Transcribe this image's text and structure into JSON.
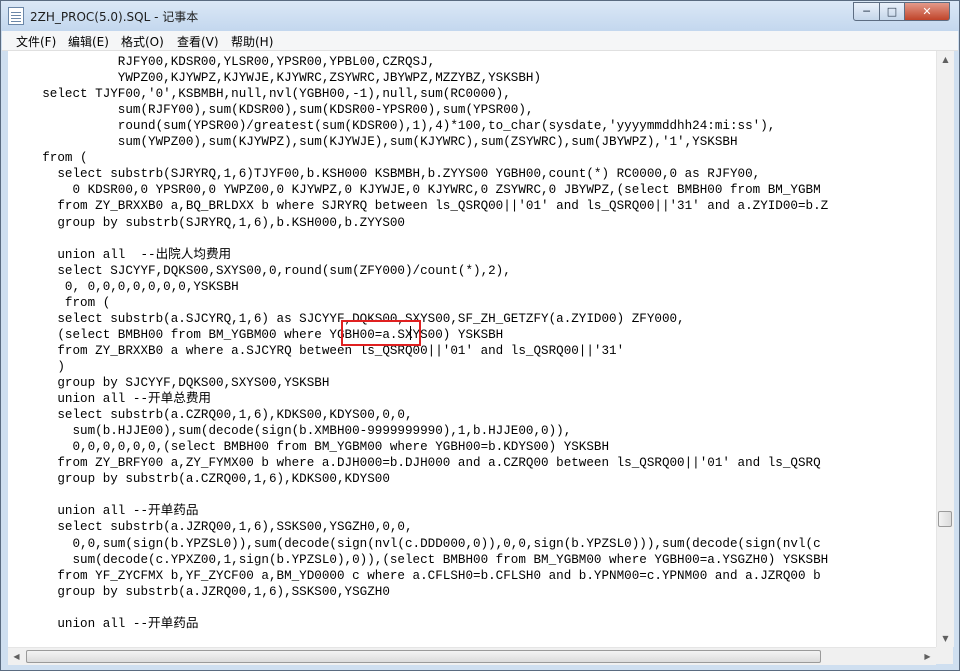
{
  "window": {
    "title": "2ZH_PROC(5.0).SQL - 记事本"
  },
  "controls": {
    "minimize": "─",
    "maximize": "□",
    "close": "✕"
  },
  "menu": [
    "文件(F)",
    "编辑(E)",
    "格式(O)",
    "查看(V)",
    "帮助(H)"
  ],
  "editor": {
    "lines": [
      "              RJFY00,KDSR00,YLSR00,YPSR00,YPBL00,CZRQSJ,",
      "              YWPZ00,KJYWPZ,KJYWJE,KJYWRC,ZSYWRC,JBYWPZ,MZZYBZ,YSKSBH)",
      "    select TJYF00,'0',KSBMBH,null,nvl(YGBH00,-1),null,sum(RC0000),",
      "              sum(RJFY00),sum(KDSR00),sum(KDSR00-YPSR00),sum(YPSR00),",
      "              round(sum(YPSR00)/greatest(sum(KDSR00),1),4)*100,to_char(sysdate,'yyyymmddhh24:mi:ss'),",
      "              sum(YWPZ00),sum(KJYWPZ),sum(KJYWJE),sum(KJYWRC),sum(ZSYWRC),sum(JBYWPZ),'1',YSKSBH",
      "    from (",
      "      select substrb(SJRYRQ,1,6)TJYF00,b.KSH000 KSBMBH,b.ZYYS00 YGBH00,count(*) RC0000,0 as RJFY00,",
      "        0 KDSR00,0 YPSR00,0 YWPZ00,0 KJYWPZ,0 KJYWJE,0 KJYWRC,0 ZSYWRC,0 JBYWPZ,(select BMBH00 from BM_YGBM",
      "      from ZY_BRXXB0 a,BQ_BRLDXX b where SJRYRQ between ls_QSRQ00||'01' and ls_QSRQ00||'31' and a.ZYID00=b.Z",
      "      group by substrb(SJRYRQ,1,6),b.KSH000,b.ZYYS00",
      "",
      "      union all  --出院人均费用",
      "      select SJCYYF,DQKS00,SXYS00,0,round(sum(ZFY000)/count(*),2),",
      "       0, 0,0,0,0,0,0,0,YSKSBH",
      "       from (",
      "      select substrb(a.SJCYRQ,1,6) as SJCYYF,DQKS00,SXYS00,SF_ZH_GETZFY(a.ZYID00) ZFY000,",
      "      (select BMBH00 from BM_YGBM00 where YGBH00=a.SXYS00) YSKSBH",
      "      from ZY_BRXXB0 a where a.SJCYRQ between ls_QSRQ00||'01' and ls_QSRQ00||'31'",
      "      )",
      "      group by SJCYYF,DQKS00,SXYS00,YSKSBH",
      "      union all --开单总费用",
      "      select substrb(a.CZRQ00,1,6),KDKS00,KDYS00,0,0,",
      "        sum(b.HJJE00),sum(decode(sign(b.XMBH00-9999999990),1,b.HJJE00,0)),",
      "        0,0,0,0,0,0,(select BMBH00 from BM_YGBM00 where YGBH00=b.KDYS00) YSKSBH",
      "      from ZY_BRFY00 a,ZY_FYMX00 b where a.DJH000=b.DJH000 and a.CZRQ00 between ls_QSRQ00||'01' and ls_QSRQ",
      "      group by substrb(a.CZRQ00,1,6),KDKS00,KDYS00",
      "",
      "      union all --开单药品",
      "      select substrb(a.JZRQ00,1,6),SSKS00,YSGZH0,0,0,",
      "        0,0,sum(sign(b.YPZSL0)),sum(decode(sign(nvl(c.DDD000,0)),0,0,sign(b.YPZSL0))),sum(decode(sign(nvl(c",
      "        sum(decode(c.YPXZ00,1,sign(b.YPZSL0),0)),(select BMBH00 from BM_YGBM00 where YGBH00=a.YSGZH0) YSKSBH",
      "      from YF_ZYCFMX b,YF_ZYCF00 a,BM_YD0000 c where a.CFLSH0=b.CFLSH0 and b.YPNM00=c.YPNM00 and a.JZRQ00 b",
      "      group by substrb(a.JZRQ00,1,6),SSKS00,YSGZH0",
      "",
      "      union all --开单药品"
    ]
  }
}
